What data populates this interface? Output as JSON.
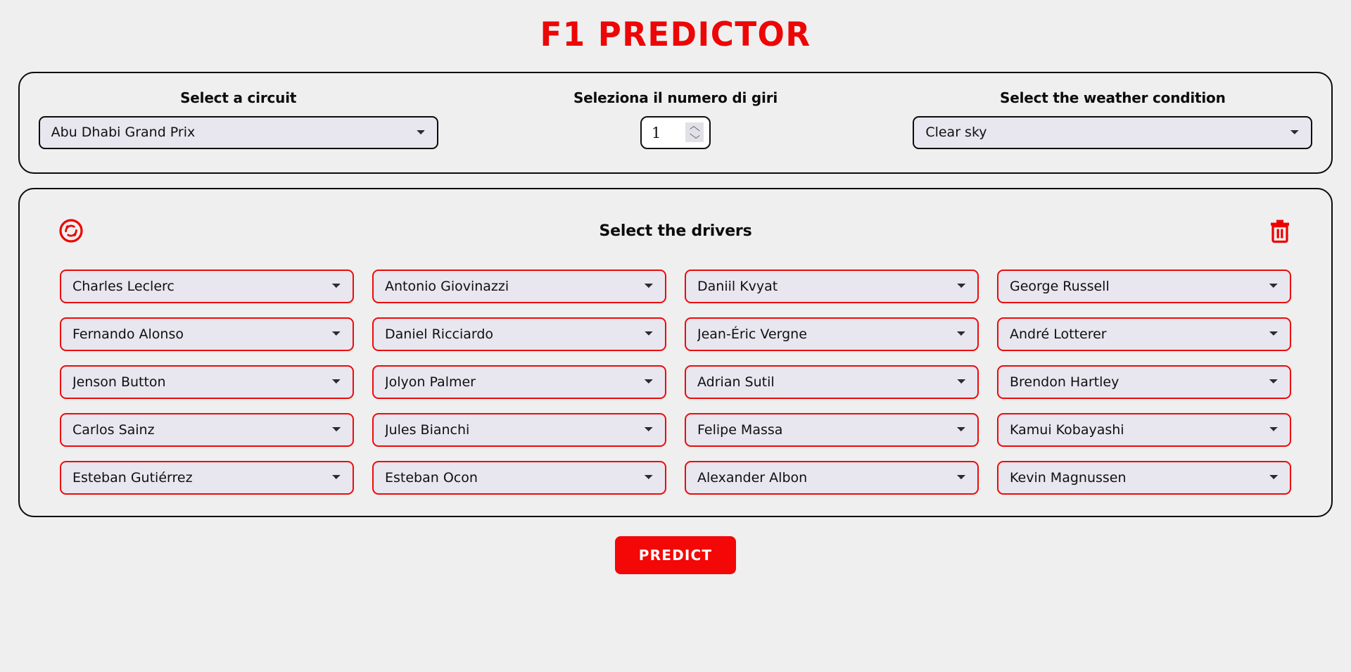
{
  "app": {
    "title": "F1 PREDICTOR",
    "accent_color": "#ed0606",
    "background_color": "#efefef"
  },
  "settings": {
    "circuit": {
      "label": "Select a circuit",
      "value": "Abu Dhabi Grand Prix"
    },
    "laps": {
      "label": "Seleziona il numero di giri",
      "value": "1"
    },
    "weather": {
      "label": "Select the weather condition",
      "value": "Clear sky"
    }
  },
  "drivers_panel": {
    "title": "Select the drivers",
    "reset_icon": "refresh-circle-icon",
    "clear_icon": "trash-icon",
    "drivers": [
      "Charles Leclerc",
      "Antonio Giovinazzi",
      "Daniil Kvyat",
      "George Russell",
      "Fernando Alonso",
      "Daniel Ricciardo",
      "Jean-Éric Vergne",
      "André Lotterer",
      "Jenson Button",
      "Jolyon Palmer",
      "Adrian Sutil",
      "Brendon Hartley",
      "Carlos Sainz",
      "Jules Bianchi",
      "Felipe Massa",
      "Kamui Kobayashi",
      "Esteban Gutiérrez",
      "Esteban Ocon",
      "Alexander Albon",
      "Kevin Magnussen"
    ]
  },
  "actions": {
    "predict_label": "PREDICT"
  }
}
